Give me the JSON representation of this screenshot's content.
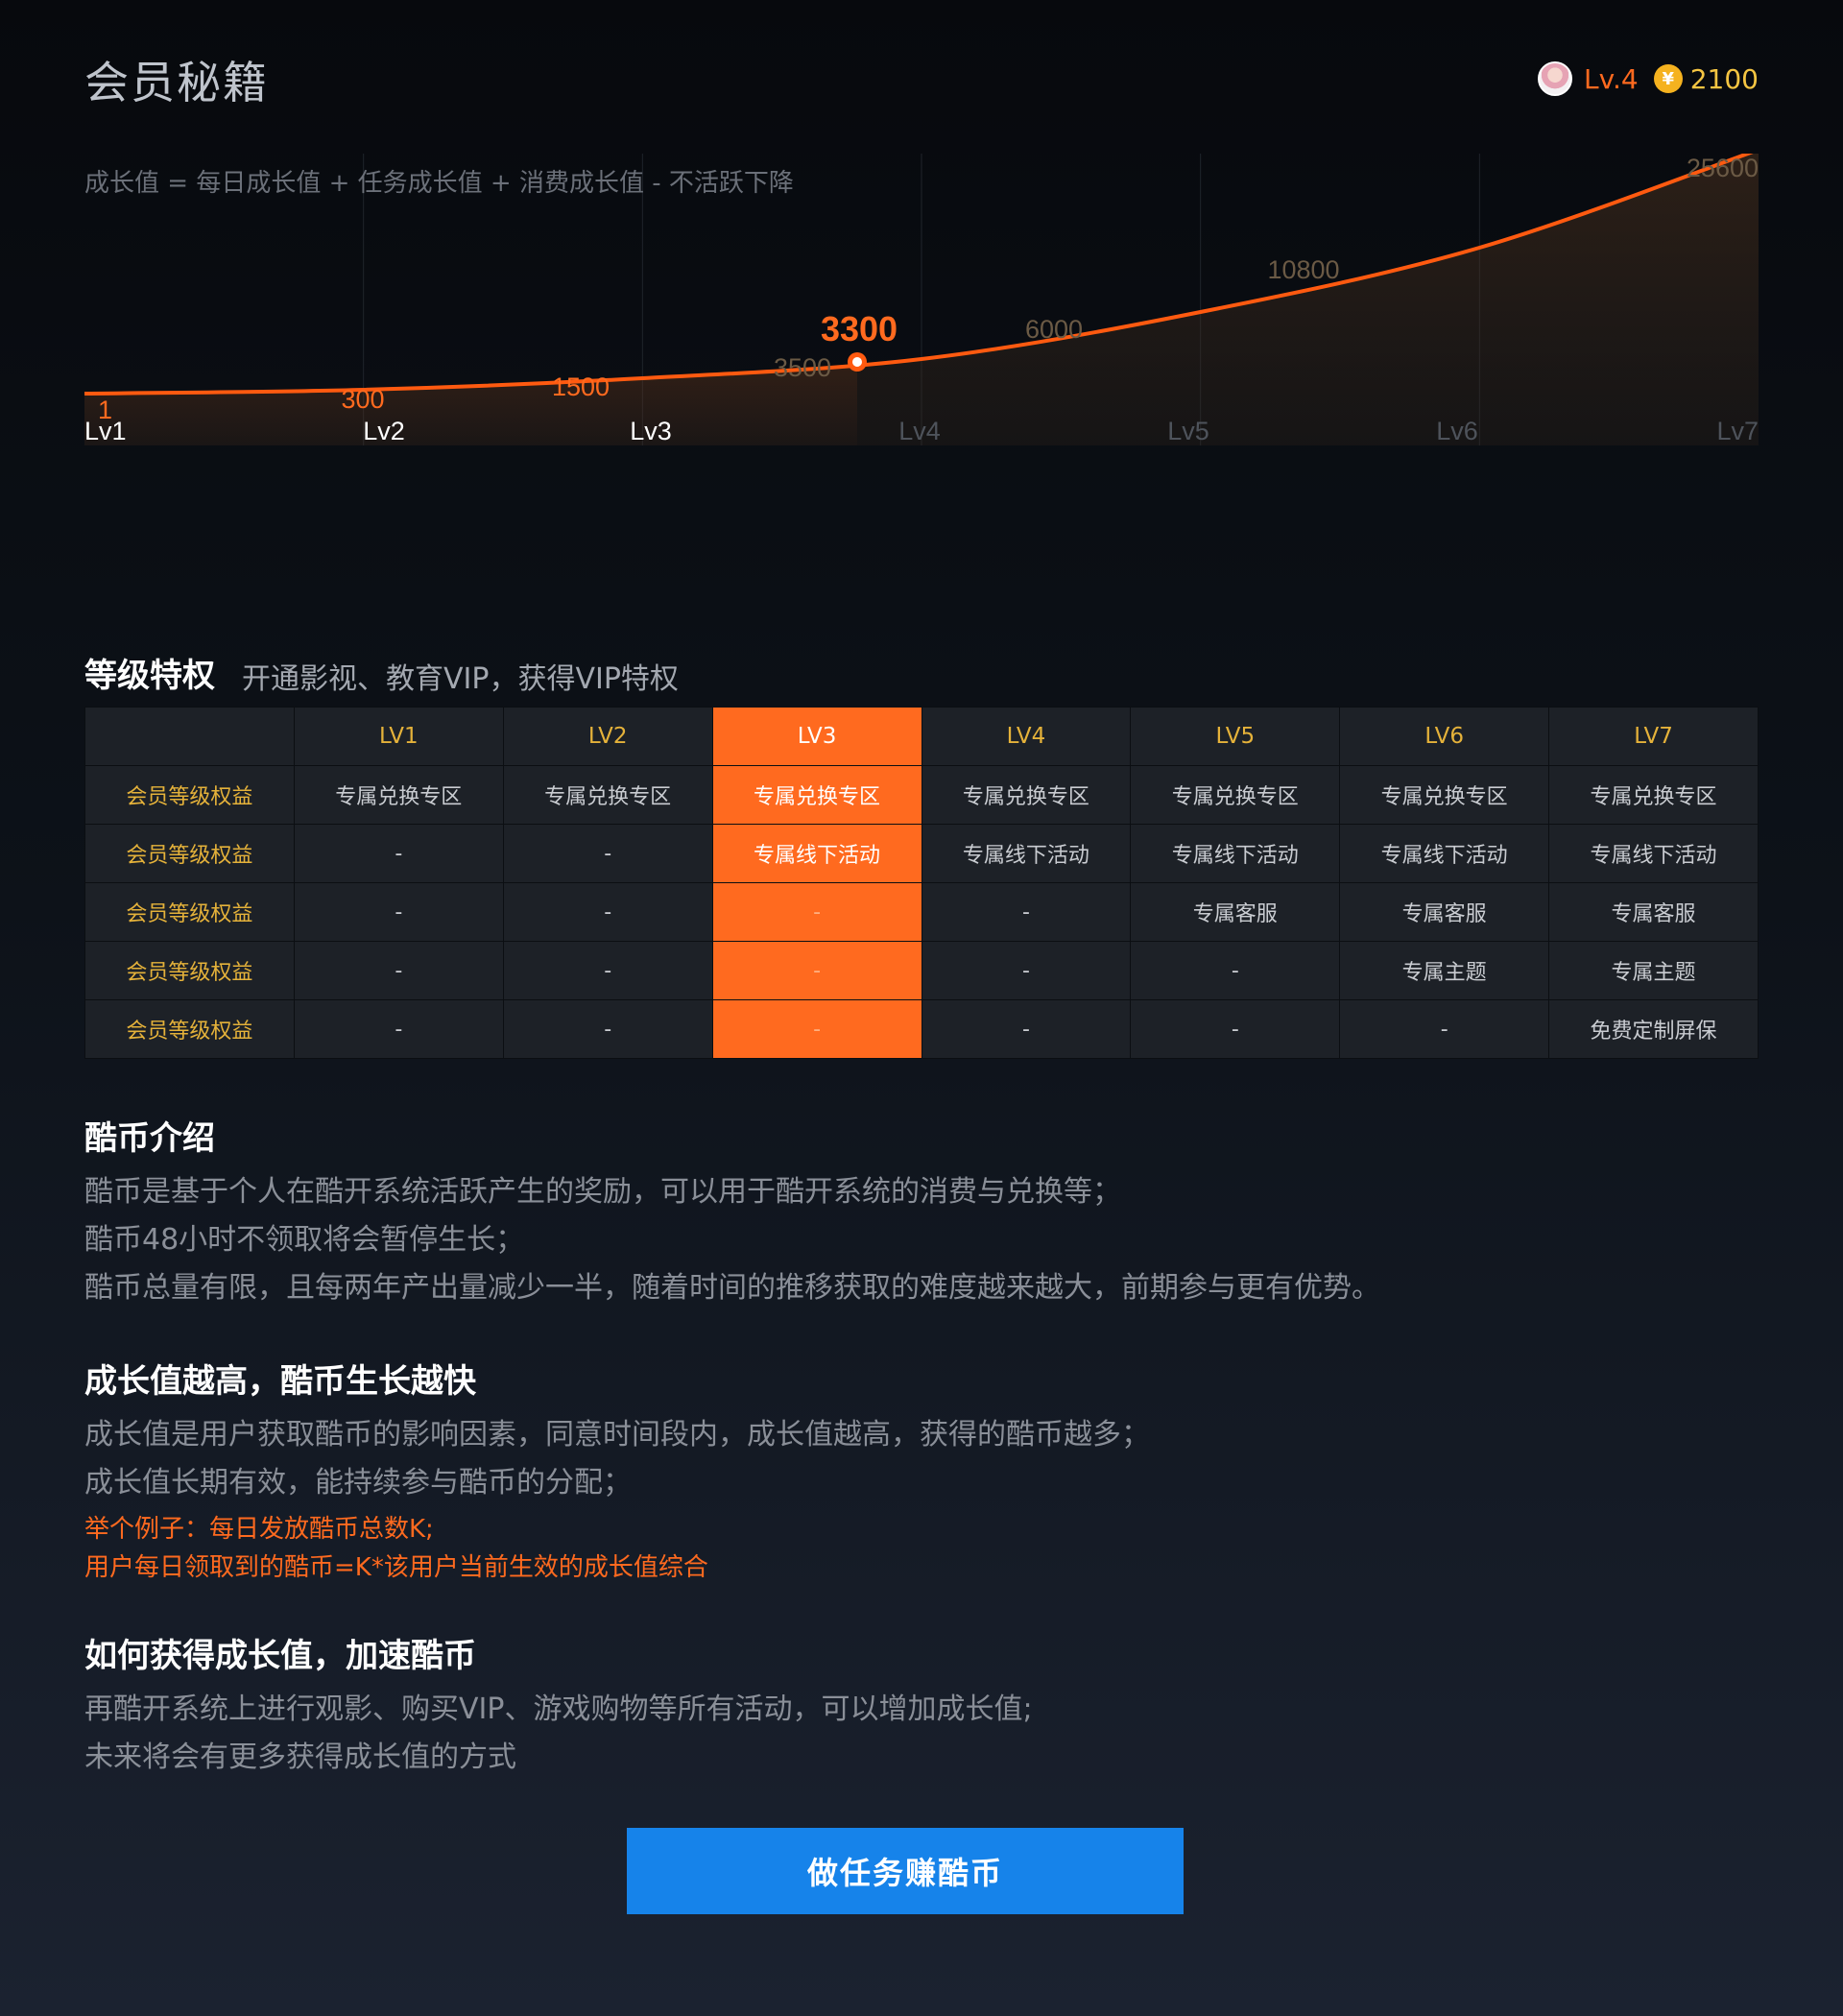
{
  "header": {
    "title": "会员秘籍",
    "level": "Lv.4",
    "coin_symbol": "¥",
    "coins": "2100"
  },
  "chart_data": {
    "type": "area",
    "title": "成长值 = 每日成长值 + 任务成长值 + 消费成长值 -  不活跃下降",
    "categories": [
      "Lv1",
      "Lv2",
      "Lv3",
      "Lv4",
      "Lv5",
      "Lv6",
      "Lv7"
    ],
    "values": [
      1,
      300,
      1500,
      3500,
      6000,
      10800,
      25600
    ],
    "value_labels": [
      "1",
      "300",
      "1500",
      "3500",
      "6000",
      "10800",
      "25600"
    ],
    "current": {
      "value": 3300,
      "label": "3300"
    },
    "colors": {
      "line": "#ff5a10",
      "reached": "#ff6a1f",
      "unreached": "#6b5a45"
    }
  },
  "privileges": {
    "title": "等级特权",
    "subtitle": "开通影视、教育VIP，获得VIP特权",
    "columns": [
      "LV1",
      "LV2",
      "LV3",
      "LV4",
      "LV5",
      "LV6",
      "LV7"
    ],
    "highlight_index": 2,
    "rows": [
      {
        "label": "会员等级权益",
        "cells": [
          "专属兑换专区",
          "专属兑换专区",
          "专属兑换专区",
          "专属兑换专区",
          "专属兑换专区",
          "专属兑换专区",
          "专属兑换专区"
        ]
      },
      {
        "label": "会员等级权益",
        "cells": [
          "-",
          "-",
          "专属线下活动",
          "专属线下活动",
          "专属线下活动",
          "专属线下活动",
          "专属线下活动"
        ]
      },
      {
        "label": "会员等级权益",
        "cells": [
          "-",
          "-",
          "-",
          "-",
          "专属客服",
          "专属客服",
          "专属客服"
        ]
      },
      {
        "label": "会员等级权益",
        "cells": [
          "-",
          "-",
          "-",
          "-",
          "-",
          "专属主题",
          "专属主题"
        ]
      },
      {
        "label": "会员等级权益",
        "cells": [
          "-",
          "-",
          "-",
          "-",
          "-",
          "-",
          "免费定制屏保"
        ]
      }
    ]
  },
  "coin_intro": {
    "title": "酷币介绍",
    "lines": [
      "酷币是基于个人在酷开系统活跃产生的奖励，可以用于酷开系统的消费与兑换等；",
      "酷币48小时不领取将会暂停生长；",
      "酷币总量有限，且每两年产出量减少一半，随着时间的推移获取的难度越来越大，前期参与更有优势。"
    ]
  },
  "growth": {
    "title": "成长值越高，酷币生长越快",
    "lines": [
      "成长值是用户获取酷币的影响因素，同意时间段内，成长值越高，获得的酷币越多；",
      "成长值长期有效，能持续参与酷币的分配；"
    ],
    "example": [
      "举个例子：每日发放酷币总数K;",
      "用户每日领取到的酷币=K*该用户当前生效的成长值综合"
    ]
  },
  "how_to": {
    "title": "如何获得成长值，加速酷币",
    "lines": [
      "再酷开系统上进行观影、购买VIP、游戏购物等所有活动，可以增加成长值;",
      "未来将会有更多获得成长值的方式"
    ]
  },
  "task_button": {
    "label": "做任务赚酷币"
  }
}
